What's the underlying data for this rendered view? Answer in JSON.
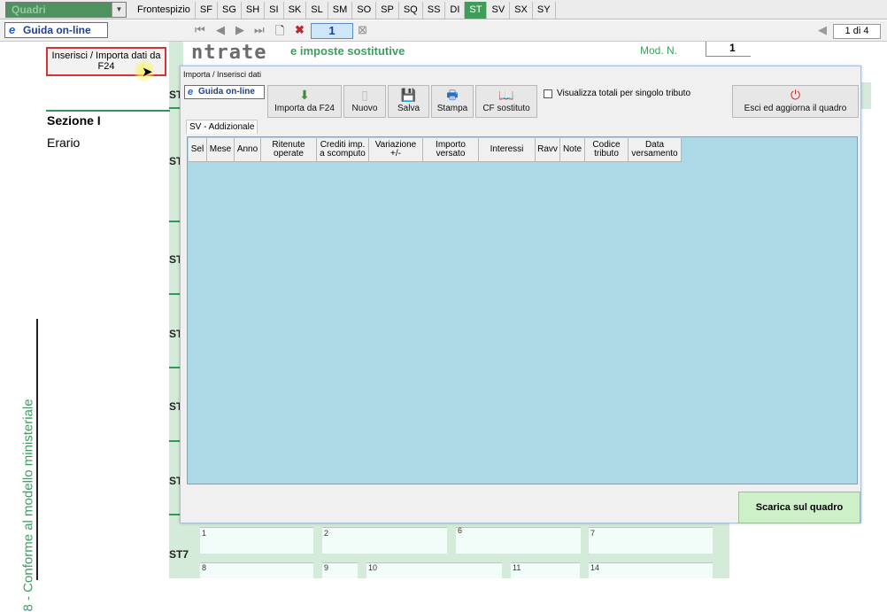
{
  "topbar": {
    "quadri": "Quadri",
    "tabs": [
      "Frontespizio",
      "SF",
      "SG",
      "SH",
      "SI",
      "SK",
      "SL",
      "SM",
      "SO",
      "SP",
      "SQ",
      "SS",
      "DI",
      "ST",
      "SV",
      "SX",
      "SY"
    ],
    "active_tab": "ST"
  },
  "toolbar": {
    "guida": "Guida on-line",
    "page_number": "1",
    "page_of": "1 di 4"
  },
  "form": {
    "logo": "ntrate",
    "logo_sub": "e imposte sostitutive",
    "mod_n_label": "Mod. N.",
    "mod_n_value": "1",
    "sezione": "Sezione I",
    "erario": "Erario",
    "vertical_text": "8 - Conforme al modello ministeriale",
    "import_button": "Inserisci / Importa dati da F24",
    "st_labels": [
      "ST",
      "ST",
      "ST",
      "ST",
      "ST",
      "ST",
      "ST7"
    ],
    "cell_numbers_row1": [
      "1",
      "2",
      "6",
      "7"
    ],
    "cell_numbers_row2": [
      "8",
      "9",
      "10",
      "11",
      "14"
    ]
  },
  "dialog": {
    "title": "Importa / Inserisci dati",
    "guida": "Guida on-line",
    "buttons": [
      {
        "label": "Importa da F24",
        "icon": "import-icon"
      },
      {
        "label": "Nuovo",
        "icon": "new-doc-icon"
      },
      {
        "label": "Salva",
        "icon": "floppy-icon"
      },
      {
        "label": "Stampa",
        "icon": "printer-icon"
      },
      {
        "label": "CF sostituto",
        "icon": "book-icon"
      }
    ],
    "checkbox_label": "Visualizza totali per singolo tributo",
    "exit_button": "Esci ed aggiorna il quadro",
    "tab": "SV - Addizionale",
    "columns": [
      "Sel",
      "Mese",
      "Anno",
      "Ritenute operate",
      "Crediti imp. a scomputo",
      "Variazione +/-",
      "Importo versato",
      "Interessi",
      "Ravv",
      "Note",
      "Codice tributo",
      "Data versamento"
    ],
    "scarica_button": "Scarica sul quadro"
  }
}
